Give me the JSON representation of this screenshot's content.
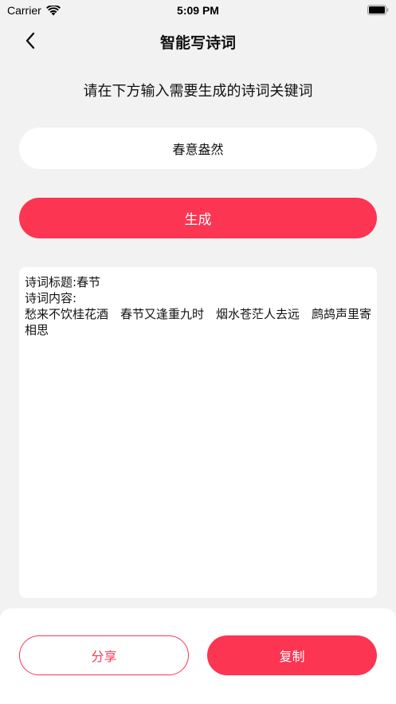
{
  "status_bar": {
    "carrier": "Carrier",
    "time": "5:09 PM",
    "icons": [
      "wifi-icon",
      "battery-icon"
    ]
  },
  "header": {
    "title": "智能写诗词",
    "back_icon": "chevron-left-icon"
  },
  "instruction": "请在下方输入需要生成的诗词关键词",
  "keyword_input": {
    "value": "春意盎然"
  },
  "generate_button": {
    "label": "生成"
  },
  "result": {
    "title_line": "诗词标题:春节",
    "content_label": "诗词内容:",
    "content": "愁来不饮桂花酒　春节又逢重九时　烟水苍茫人去远　鹧鸪声里寄相思"
  },
  "actions": {
    "share_label": "分享",
    "copy_label": "复制"
  },
  "colors": {
    "accent": "#fb3552",
    "background": "#f2f2f2",
    "card": "#ffffff"
  }
}
